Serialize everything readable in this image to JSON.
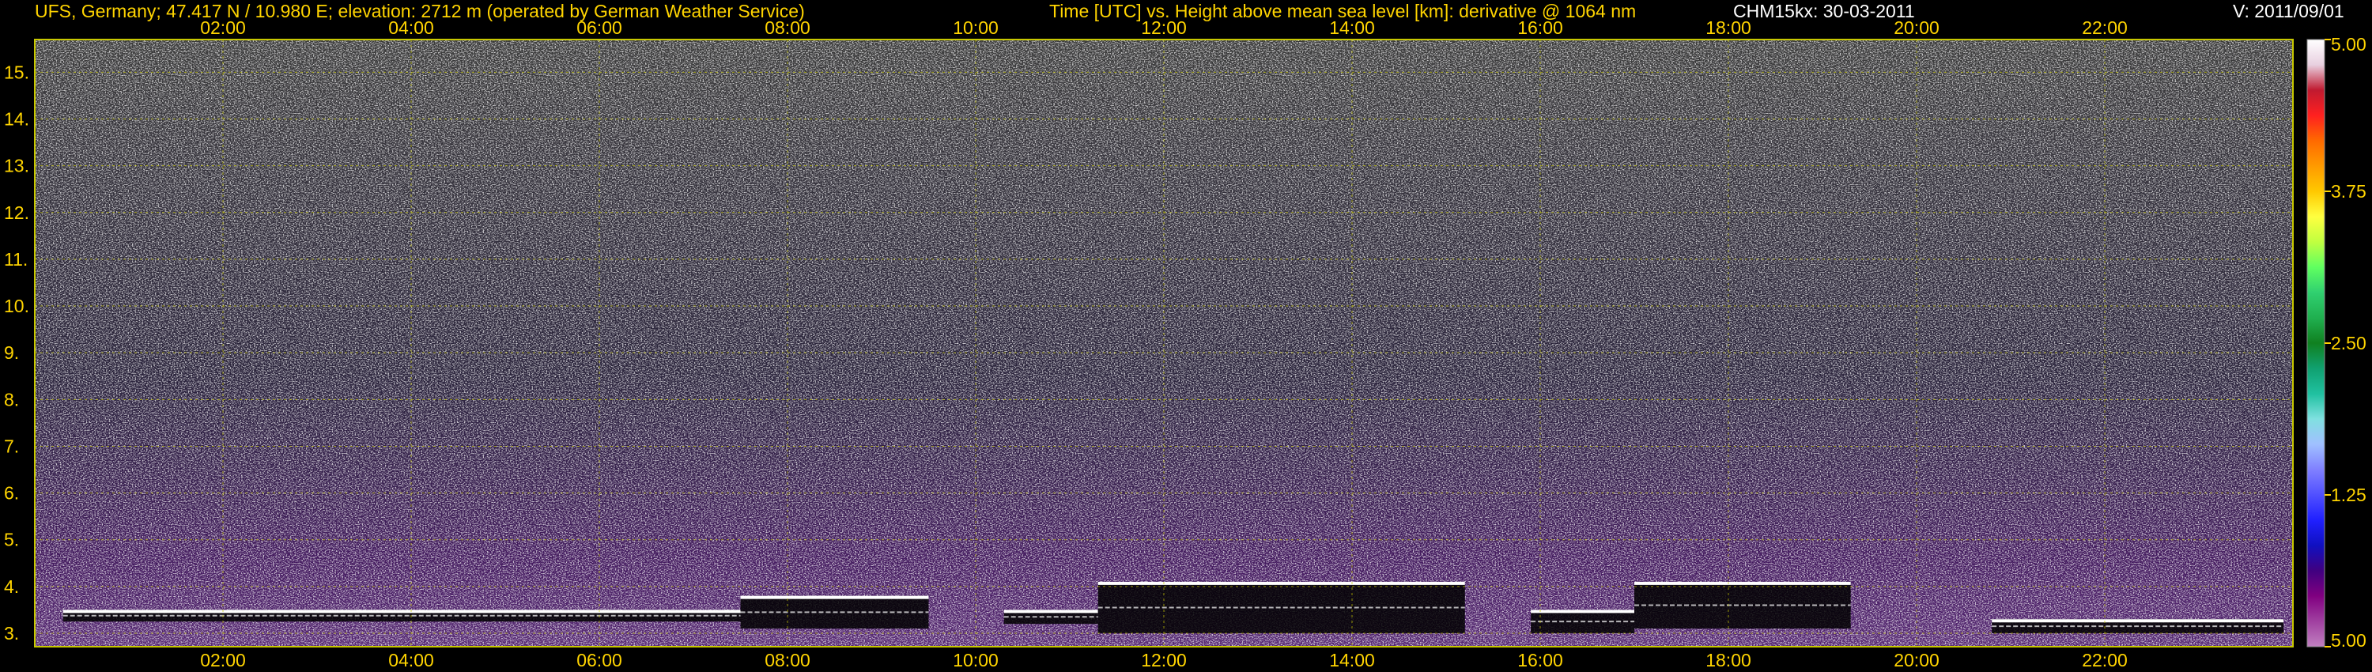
{
  "header": {
    "site": "UFS, Germany; 47.417 N / 10.980 E; elevation: 2712 m  (operated by German Weather Service)",
    "description": "Time [UTC] vs. Height above mean sea level [km]: derivative @ 1064 nm",
    "instrument_date": "CHM15kx: 30-03-2011",
    "version": "V: 2011/09/01"
  },
  "colors": {
    "background": "#000000",
    "grid": "#c8c800",
    "label": "#ffd400",
    "header_white": "#ffffff",
    "noise_light": "#dcdcdc",
    "low_layer": "#5a2a78",
    "cloud": "#ffffff"
  },
  "chart_data": {
    "type": "heatmap",
    "title": "Time [UTC] vs. Height above mean sea level [km]: derivative @ 1064 nm",
    "xlabel": "",
    "ylabel": "",
    "x_ticks": [
      "02:00",
      "04:00",
      "06:00",
      "08:00",
      "10:00",
      "12:00",
      "14:00",
      "16:00",
      "18:00",
      "20:00",
      "22:00"
    ],
    "x_tick_hours": [
      2,
      4,
      6,
      8,
      10,
      12,
      14,
      16,
      18,
      20,
      22
    ],
    "xlim": [
      0,
      24
    ],
    "y_ticks": [
      "3.",
      "4.",
      "5.",
      "6.",
      "7.",
      "8.",
      "9.",
      "10.",
      "11.",
      "12.",
      "13.",
      "14.",
      "15."
    ],
    "y_tick_values": [
      3,
      4,
      5,
      6,
      7,
      8,
      9,
      10,
      11,
      12,
      13,
      14,
      15
    ],
    "ylim": [
      2.712,
      15.7
    ],
    "grid": true,
    "colorbar": {
      "ticks": [
        "5.00",
        "3.75",
        "2.50",
        "1.25",
        "5.00"
      ],
      "tick_positions": [
        0,
        0.25,
        0.5,
        0.75,
        1
      ],
      "colors": [
        "#ffffff",
        "#e8d0e0",
        "#c01a30",
        "#ff2020",
        "#ff6a00",
        "#ff9a00",
        "#ffc800",
        "#ffff40",
        "#c0ff40",
        "#60ff60",
        "#30d070",
        "#20b050",
        "#108020",
        "#10a070",
        "#20c0a0",
        "#80e0e0",
        "#a0c0ff",
        "#8080ff",
        "#5050ff",
        "#2020ff",
        "#1010c0",
        "#400080",
        "#800080",
        "#a040a0",
        "#c080c0"
      ]
    },
    "cloud_layers": [
      {
        "start": 0.3,
        "end": 7.5,
        "base": 3.25,
        "top": 3.5
      },
      {
        "start": 7.5,
        "end": 9.5,
        "base": 3.1,
        "top": 3.8
      },
      {
        "start": 10.3,
        "end": 11.3,
        "base": 3.2,
        "top": 3.5
      },
      {
        "start": 11.3,
        "end": 15.2,
        "base": 3.0,
        "top": 4.1
      },
      {
        "start": 15.9,
        "end": 17.0,
        "base": 3.0,
        "top": 3.5
      },
      {
        "start": 17.0,
        "end": 19.3,
        "base": 3.1,
        "top": 4.1
      },
      {
        "start": 20.8,
        "end": 23.9,
        "base": 3.0,
        "top": 3.3
      }
    ]
  }
}
